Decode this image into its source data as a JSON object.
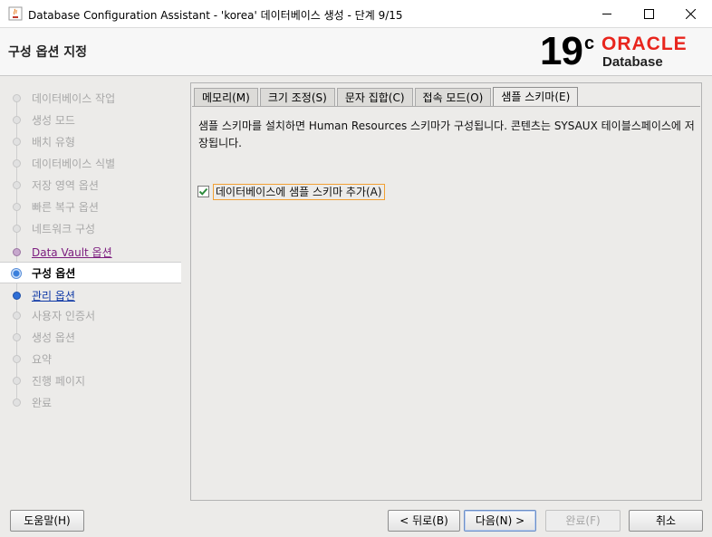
{
  "window": {
    "title": "Database Configuration Assistant - 'korea' 데이터베이스 생성 - 단계 9/15"
  },
  "header": {
    "page_title": "구성 옵션 지정",
    "logo_version": "19",
    "logo_sup": "c",
    "logo_brand": "ORACLE",
    "logo_product": "Database",
    "brand_color": "#e8251d"
  },
  "steps": [
    {
      "label": "데이터베이스 작업",
      "state": "disabled"
    },
    {
      "label": "생성 모드",
      "state": "disabled"
    },
    {
      "label": "배치 유형",
      "state": "disabled"
    },
    {
      "label": "데이터베이스 식별",
      "state": "disabled"
    },
    {
      "label": "저장 영역 옵션",
      "state": "disabled"
    },
    {
      "label": "빠른 복구 옵션",
      "state": "disabled"
    },
    {
      "label": "네트워크 구성",
      "state": "disabled"
    },
    {
      "label": "Data Vault 옵션",
      "state": "visited"
    },
    {
      "label": "구성 옵션",
      "state": "current"
    },
    {
      "label": "관리 옵션",
      "state": "link"
    },
    {
      "label": "사용자 인증서",
      "state": "disabled"
    },
    {
      "label": "생성 옵션",
      "state": "disabled"
    },
    {
      "label": "요약",
      "state": "disabled"
    },
    {
      "label": "진행 페이지",
      "state": "disabled"
    },
    {
      "label": "완료",
      "state": "disabled"
    }
  ],
  "tabs": [
    {
      "label": "메모리(M)",
      "active": false
    },
    {
      "label": "크기 조정(S)",
      "active": false
    },
    {
      "label": "문자 집합(C)",
      "active": false
    },
    {
      "label": "접속 모드(O)",
      "active": false
    },
    {
      "label": "샘플 스키마(E)",
      "active": true
    }
  ],
  "content": {
    "description": "샘플 스키마를 설치하면 Human Resources 스키마가 구성됩니다. 콘텐츠는 SYSAUX 테이블스페이스에 저장됩니다.",
    "checkbox_label": "데이터베이스에 샘플 스키마 추가(A)",
    "checkbox_checked": true
  },
  "buttons": {
    "help": "도움말(H)",
    "back": "< 뒤로(B)",
    "next": "다음(N) >",
    "finish": "완료(F)",
    "cancel": "취소"
  }
}
